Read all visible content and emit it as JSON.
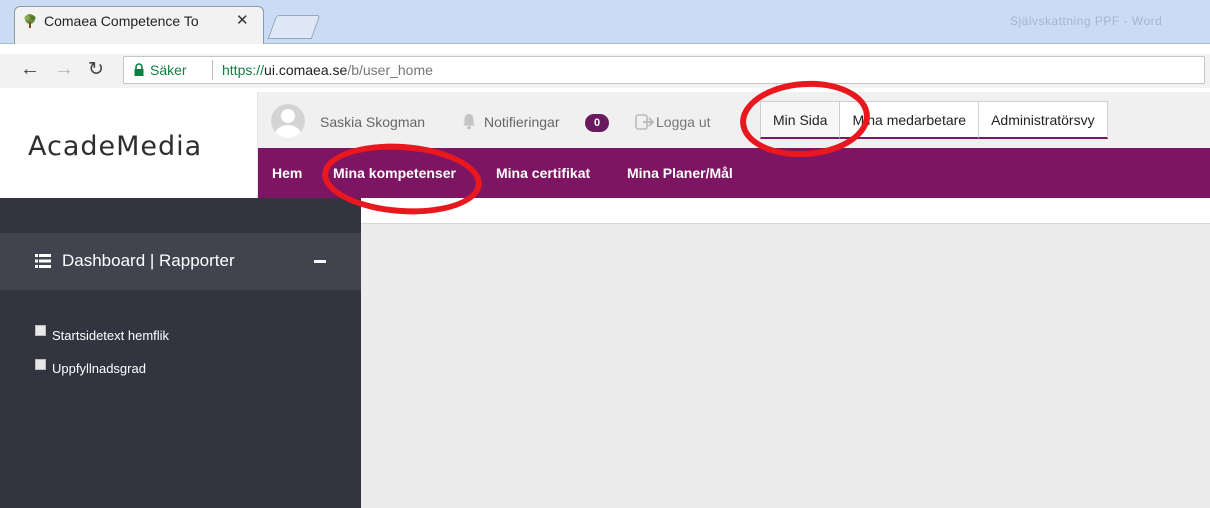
{
  "browser": {
    "tab_title": "Comaea Competence To",
    "tab_close": "✕",
    "ghost_title": "Självskattning PPF - Word",
    "secure_label": "Säker",
    "url_proto": "https://",
    "url_host": "ui.comaea.se",
    "url_path": "/b/user_home"
  },
  "header": {
    "logo": "AcadeMedia",
    "user_name": "Saskia Skogman",
    "notifications_label": "Notifieringar",
    "notifications_count": "0",
    "logout_label": "Logga ut",
    "view_tabs": [
      "Min Sida",
      "Mina medarbetare",
      "Administratörsvy"
    ]
  },
  "nav": {
    "items": [
      "Hem",
      "Mina kompetenser",
      "Mina certifikat",
      "Mina Planer/Mål"
    ]
  },
  "sidebar": {
    "section_title": "Dashboard | Rapporter",
    "items": [
      "Startsidetext hemflik",
      "Uppfyllnadsgrad"
    ]
  },
  "colors": {
    "accent": "#7e1562",
    "sidebar_bg": "#323540",
    "annotation": "#e8181e"
  }
}
